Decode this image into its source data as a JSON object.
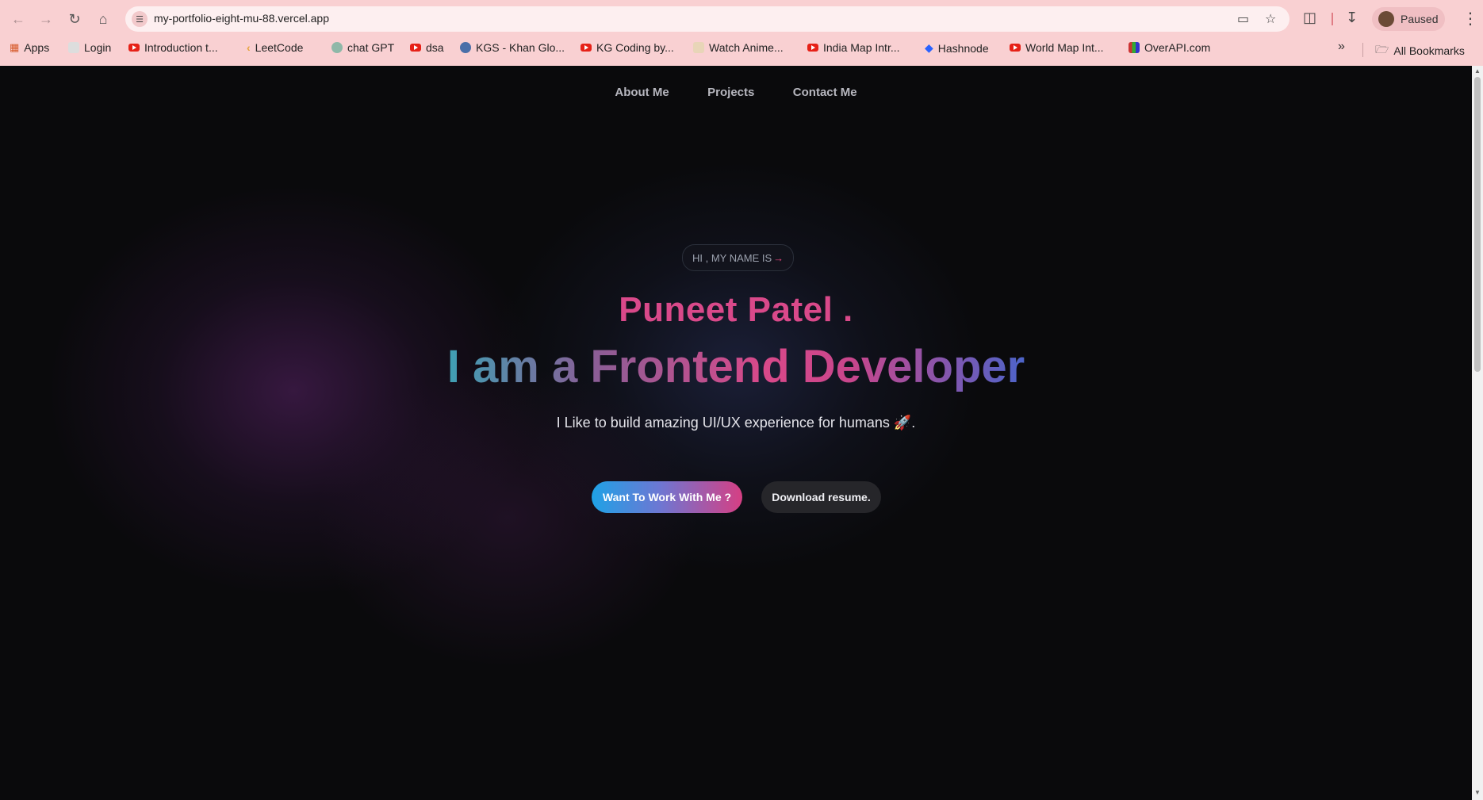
{
  "browser": {
    "url": "my-portfolio-eight-mu-88.vercel.app",
    "profile_status": "Paused",
    "bookmarks": [
      {
        "label": "Apps",
        "icon": "apps-grid-icon"
      },
      {
        "label": "Login",
        "icon": "page-icon"
      },
      {
        "label": "Introduction t...",
        "icon": "youtube-icon"
      },
      {
        "label": "LeetCode",
        "icon": "leetcode-icon"
      },
      {
        "label": "chat GPT",
        "icon": "chatgpt-icon"
      },
      {
        "label": "dsa",
        "icon": "youtube-icon"
      },
      {
        "label": "KGS - Khan Glo...",
        "icon": "kgs-icon"
      },
      {
        "label": "KG Coding by...",
        "icon": "youtube-icon"
      },
      {
        "label": "Watch Anime...",
        "icon": "anime-icon"
      },
      {
        "label": "India Map Intr...",
        "icon": "youtube-icon"
      },
      {
        "label": "Hashnode",
        "icon": "hashnode-icon"
      },
      {
        "label": "World Map Int...",
        "icon": "youtube-icon"
      },
      {
        "label": "OverAPI.com",
        "icon": "overapi-icon"
      }
    ],
    "overflow_label": "»",
    "all_bookmarks_label": "All Bookmarks"
  },
  "nav": {
    "items": [
      "About Me",
      "Projects",
      "Contact Me"
    ]
  },
  "hero": {
    "intro": "HI , MY NAME IS",
    "intro_arrow": "→",
    "name": "Puneet Patel .",
    "headline": "I am a Frontend Developer",
    "tagline": "I Like to build amazing UI/UX experience for humans 🚀.",
    "primary_button": "Want To Work With Me ?",
    "secondary_button": "Download resume."
  },
  "colors": {
    "background": "#0a0a0c",
    "accent_pink": "#d9498a",
    "accent_blue": "#1fa2e6",
    "chrome": "#f9d0d2"
  }
}
